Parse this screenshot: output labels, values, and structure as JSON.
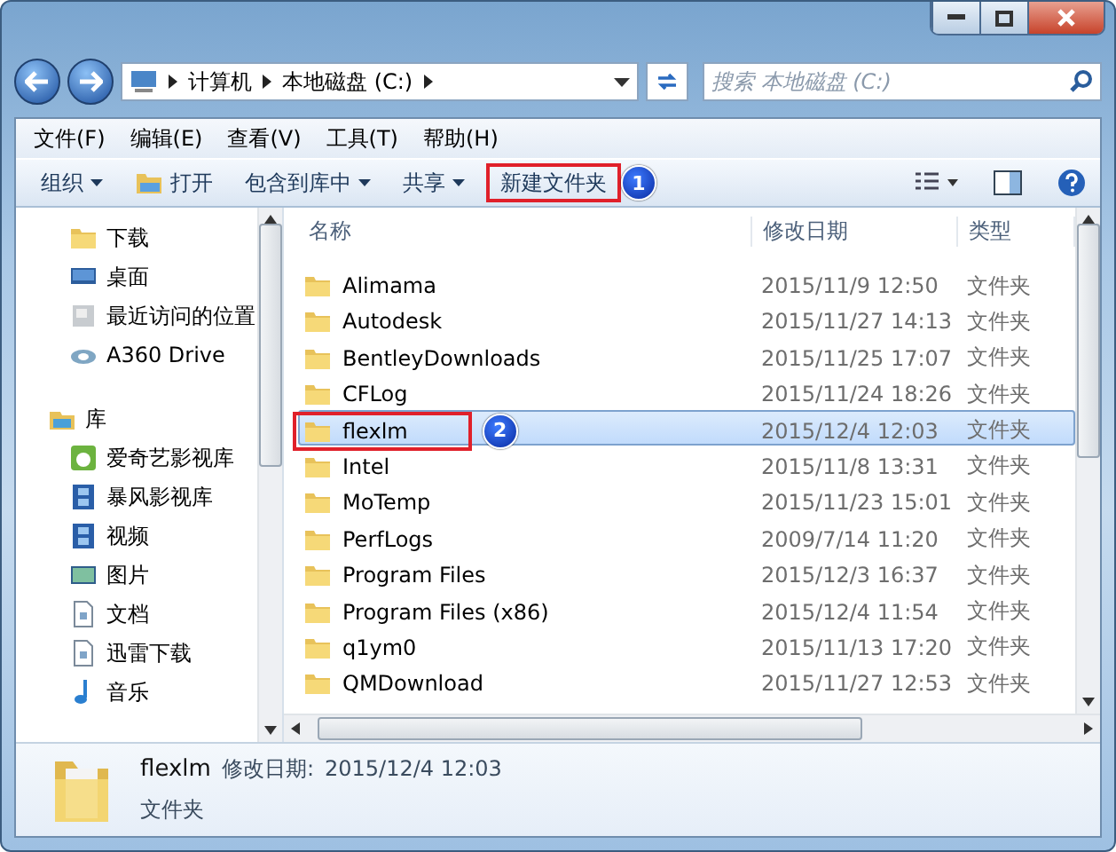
{
  "address": {
    "crumbs": [
      "计算机",
      "本地磁盘 (C:)"
    ]
  },
  "search": {
    "placeholder": "搜索 本地磁盘 (C:)"
  },
  "menu": [
    "文件(F)",
    "编辑(E)",
    "查看(V)",
    "工具(T)",
    "帮助(H)"
  ],
  "toolbar": [
    {
      "label": "组织",
      "kind": "dropdown"
    },
    {
      "label": "打开",
      "kind": "open"
    },
    {
      "label": "包含到库中",
      "kind": "dropdown"
    },
    {
      "label": "共享",
      "kind": "dropdown"
    },
    {
      "label": "新建文件夹",
      "kind": "plain",
      "callout": "1"
    }
  ],
  "nav": {
    "favorites": [
      {
        "label": "下载",
        "kind": "folder"
      },
      {
        "label": "桌面",
        "kind": "desktop"
      },
      {
        "label": "最近访问的位置",
        "kind": "recent"
      },
      {
        "label": "A360 Drive",
        "kind": "cloud"
      }
    ],
    "library": {
      "label": "库",
      "kind": "library",
      "children": [
        {
          "label": "爱奇艺影视库",
          "kind": "media"
        },
        {
          "label": "暴风影视库",
          "kind": "film"
        },
        {
          "label": "视频",
          "kind": "film"
        },
        {
          "label": "图片",
          "kind": "picture"
        },
        {
          "label": "文档",
          "kind": "document"
        },
        {
          "label": "迅雷下载",
          "kind": "document"
        },
        {
          "label": "音乐",
          "kind": "music"
        }
      ]
    }
  },
  "table": {
    "columns": [
      "名称",
      "修改日期",
      "类型"
    ],
    "rows": [
      {
        "name": "Alimama",
        "date": "2015/11/9 12:50",
        "type": "文件夹",
        "selected": false
      },
      {
        "name": "Autodesk",
        "date": "2015/11/27 14:13",
        "type": "文件夹",
        "selected": false
      },
      {
        "name": "BentleyDownloads",
        "date": "2015/11/25 17:07",
        "type": "文件夹",
        "selected": false
      },
      {
        "name": "CFLog",
        "date": "2015/11/24 18:26",
        "type": "文件夹",
        "selected": false
      },
      {
        "name": "flexlm",
        "date": "2015/12/4 12:03",
        "type": "文件夹",
        "selected": true,
        "callout": "2"
      },
      {
        "name": "Intel",
        "date": "2015/11/8 13:31",
        "type": "文件夹",
        "selected": false
      },
      {
        "name": "MoTemp",
        "date": "2015/11/23 15:01",
        "type": "文件夹",
        "selected": false
      },
      {
        "name": "PerfLogs",
        "date": "2009/7/14 11:20",
        "type": "文件夹",
        "selected": false
      },
      {
        "name": "Program Files",
        "date": "2015/12/3 16:37",
        "type": "文件夹",
        "selected": false
      },
      {
        "name": "Program Files (x86)",
        "date": "2015/12/4 11:54",
        "type": "文件夹",
        "selected": false
      },
      {
        "name": "q1ym0",
        "date": "2015/11/13 17:20",
        "type": "文件夹",
        "selected": false
      },
      {
        "name": "QMDownload",
        "date": "2015/11/27 12:53",
        "type": "文件夹",
        "selected": false
      }
    ]
  },
  "details": {
    "name": "flexlm",
    "date_label": "修改日期:",
    "date": "2015/12/4 12:03",
    "type": "文件夹"
  }
}
